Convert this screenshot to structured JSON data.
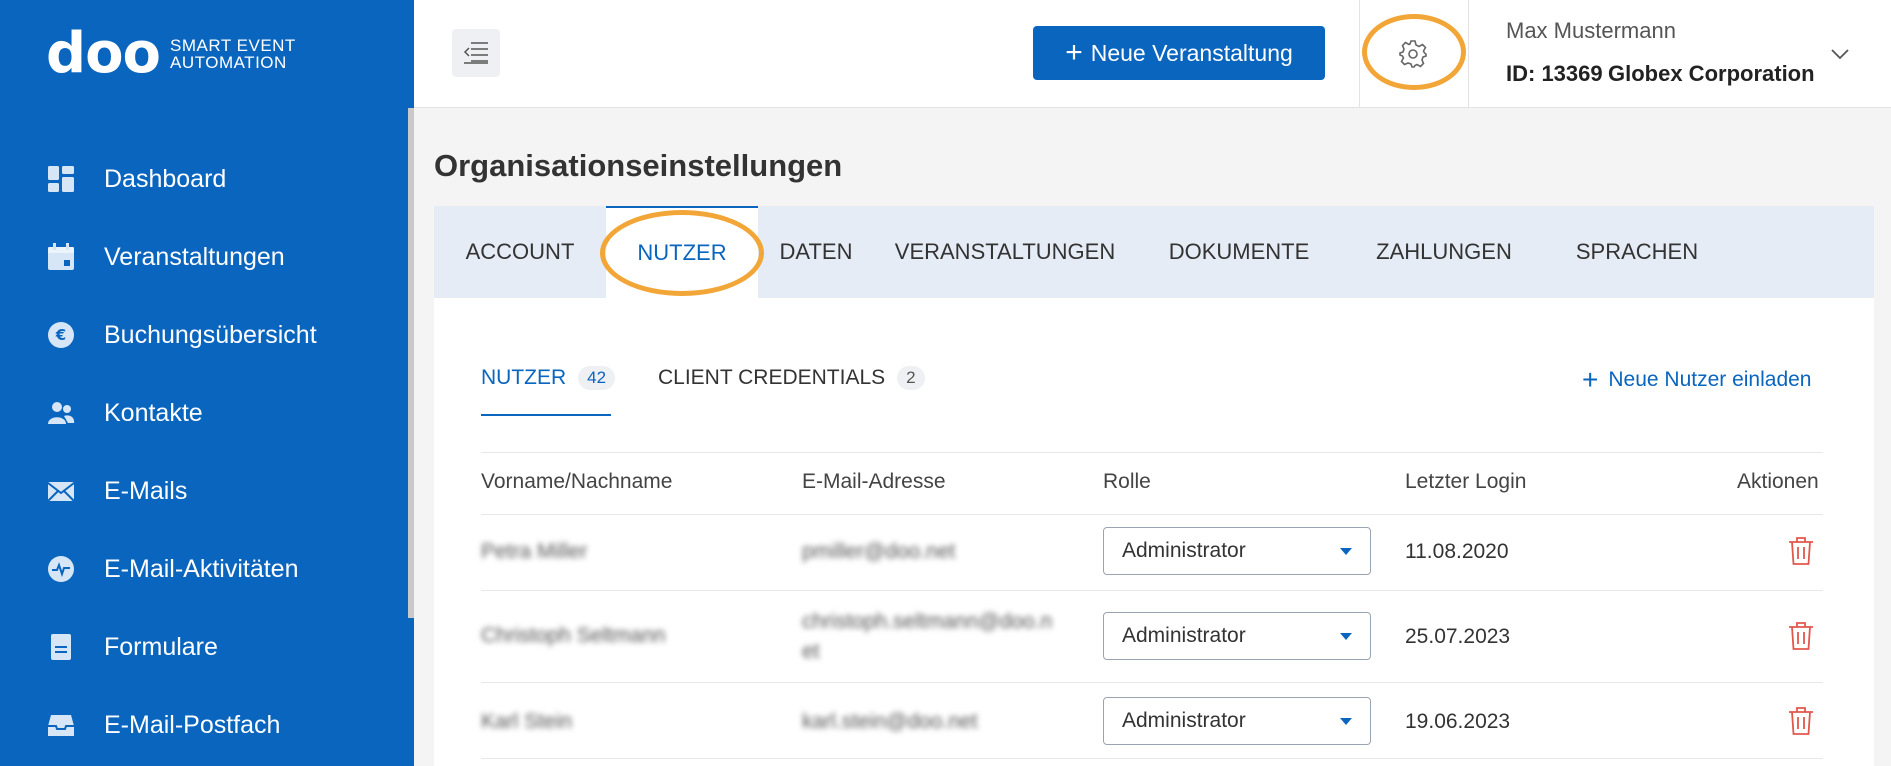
{
  "brand": {
    "logo": "doo",
    "tagline_line1": "SMART EVENT",
    "tagline_line2": "AUTOMATION"
  },
  "sidebar": {
    "items": [
      {
        "label": "Dashboard",
        "icon": "dashboard-icon"
      },
      {
        "label": "Veranstaltungen",
        "icon": "calendar-icon"
      },
      {
        "label": "Buchungsübersicht",
        "icon": "euro-icon"
      },
      {
        "label": "Kontakte",
        "icon": "contacts-icon"
      },
      {
        "label": "E-Mails",
        "icon": "mail-icon"
      },
      {
        "label": "E-Mail-Aktivitäten",
        "icon": "activity-icon"
      },
      {
        "label": "Formulare",
        "icon": "form-icon"
      },
      {
        "label": "E-Mail-Postfach",
        "icon": "inbox-icon"
      }
    ]
  },
  "header": {
    "new_event_label": "Neue Veranstaltung",
    "user_name": "Max Mustermann",
    "user_id": "ID: 13369",
    "organization": "Globex Corporation"
  },
  "page": {
    "title": "Organisationseinstellungen",
    "tabs": [
      "ACCOUNT",
      "NUTZER",
      "DATEN",
      "VERANSTALTUNGEN",
      "DOKUMENTE",
      "ZAHLUNGEN",
      "SPRACHEN"
    ],
    "active_tab": "NUTZER"
  },
  "users_panel": {
    "subtabs": [
      {
        "label": "NUTZER",
        "count": "42"
      },
      {
        "label": "CLIENT CREDENTIALS",
        "count": "2"
      }
    ],
    "invite_label": "Neue Nutzer einladen",
    "columns": [
      "Vorname/Nachname",
      "E-Mail-Adresse",
      "Rolle",
      "Letzter Login",
      "Aktionen"
    ],
    "rows": [
      {
        "name": "Petra Miller",
        "email_line1": "pmiller@doo.net",
        "email_line2": "",
        "role": "Administrator",
        "last_login": "11.08.2020"
      },
      {
        "name": "Christoph Seltmann",
        "email_line1": "christoph.seltmann@doo.n",
        "email_line2": "et",
        "role": "Administrator",
        "last_login": "25.07.2023"
      },
      {
        "name": "Karl Stein",
        "email_line1": "karl.stein@doo.net",
        "email_line2": "",
        "role": "Administrator",
        "last_login": "19.06.2023"
      }
    ]
  },
  "colors": {
    "primary": "#0a65bf",
    "highlight": "#f2a637",
    "danger": "#e2574c",
    "tab_bg": "#e6ecf5"
  }
}
